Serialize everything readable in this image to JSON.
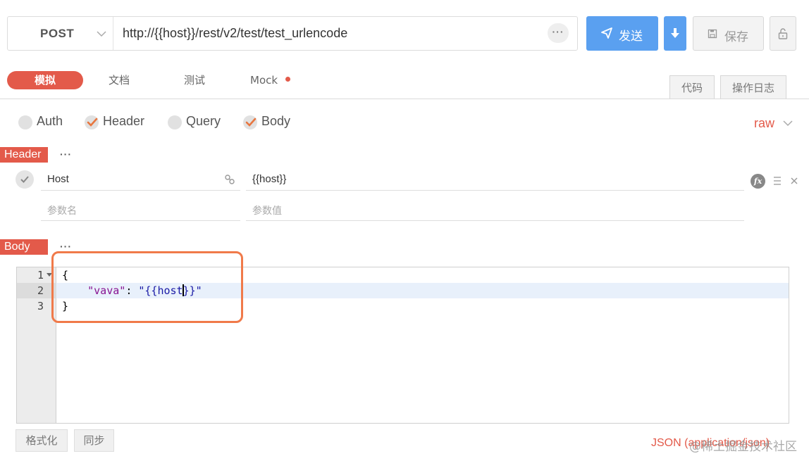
{
  "request": {
    "method": "POST",
    "url": "http://{{host}}/rest/v2/test/test_urlencode",
    "url_more": "···",
    "send_label": "发送",
    "save_label": "保存"
  },
  "tabs": {
    "items": [
      "模拟",
      "文档",
      "测试",
      "Mock"
    ],
    "active": "模拟",
    "side": [
      "代码",
      "操作日志"
    ]
  },
  "options": {
    "checkboxes": [
      {
        "label": "Auth",
        "checked": false
      },
      {
        "label": "Header",
        "checked": true
      },
      {
        "label": "Query",
        "checked": false
      },
      {
        "label": "Body",
        "checked": true
      }
    ],
    "body_format": "raw"
  },
  "header_section": {
    "title": "Header",
    "more": "···",
    "rows": [
      {
        "name": "Host",
        "value": "{{host}}",
        "enabled": true
      }
    ],
    "name_placeholder": "参数名",
    "value_placeholder": "参数值"
  },
  "body_section": {
    "title": "Body",
    "more": "···",
    "line_numbers": [
      "1",
      "2",
      "3"
    ],
    "lines": [
      "{",
      "    \"vava\": \"{{host}}\"",
      "}"
    ]
  },
  "footer": {
    "format_button": "格式化",
    "sync_button": "同步",
    "content_type": "JSON (application/json)",
    "watermark": "@稀土掘金技术社区"
  },
  "colors": {
    "accent": "#e35a4a",
    "primary": "#5aa0f0",
    "highlight": "#f07a4a"
  }
}
